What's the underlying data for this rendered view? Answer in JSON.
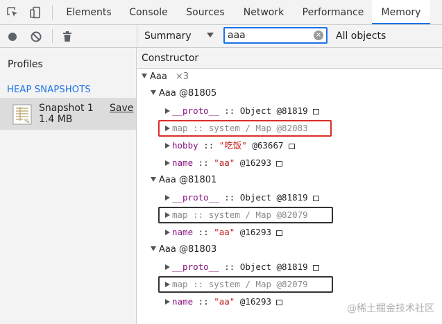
{
  "tabs": [
    {
      "label": "Elements",
      "active": false
    },
    {
      "label": "Console",
      "active": false
    },
    {
      "label": "Sources",
      "active": false
    },
    {
      "label": "Network",
      "active": false
    },
    {
      "label": "Performance",
      "active": false
    },
    {
      "label": "Memory",
      "active": true
    }
  ],
  "toolbar": {
    "view_select": "Summary",
    "filter_value": "aaa",
    "filter_clear_glyph": "×",
    "objects_select": "All objects"
  },
  "sidebar": {
    "profiles_label": "Profiles",
    "section_label": "HEAP SNAPSHOTS",
    "snapshot": {
      "name": "Snapshot 1",
      "size": "1.4 MB",
      "save_label": "Save"
    }
  },
  "table": {
    "column_header": "Constructor",
    "group": {
      "name": "Aaa",
      "count": "×3"
    },
    "instances": [
      {
        "label": "Aaa @81805",
        "props": [
          {
            "key": "__proto__",
            "sep": " :: ",
            "value": "Object",
            "id": " @81819",
            "kind": "object",
            "box": true
          },
          {
            "key": "map",
            "sep": " :: ",
            "value": "system / Map",
            "id": " @82083",
            "kind": "system",
            "box": false
          },
          {
            "key": "hobby",
            "sep": " :: ",
            "value": "\"吃饭\"",
            "id": " @63667",
            "kind": "string",
            "box": true
          },
          {
            "key": "name",
            "sep": " :: ",
            "value": "\"aa\"",
            "id": " @16293",
            "kind": "string",
            "box": true
          }
        ]
      },
      {
        "label": "Aaa @81801",
        "props": [
          {
            "key": "__proto__",
            "sep": " :: ",
            "value": "Object",
            "id": " @81819",
            "kind": "object",
            "box": true
          },
          {
            "key": "map",
            "sep": " :: ",
            "value": "system / Map",
            "id": " @82079",
            "kind": "system",
            "box": false
          },
          {
            "key": "name",
            "sep": " :: ",
            "value": "\"aa\"",
            "id": " @16293",
            "kind": "string",
            "box": true
          }
        ]
      },
      {
        "label": "Aaa @81803",
        "props": [
          {
            "key": "__proto__",
            "sep": " :: ",
            "value": "Object",
            "id": " @81819",
            "kind": "object",
            "box": true
          },
          {
            "key": "map",
            "sep": " :: ",
            "value": "system / Map",
            "id": " @82079",
            "kind": "system",
            "box": false
          },
          {
            "key": "name",
            "sep": " :: ",
            "value": "\"aa\"",
            "id": " @16293",
            "kind": "string",
            "box": true
          }
        ]
      }
    ]
  },
  "highlight_colors": {
    "first_map": "#d93025",
    "other_maps": "#333333"
  },
  "watermark": "@稀土掘金技术社区"
}
